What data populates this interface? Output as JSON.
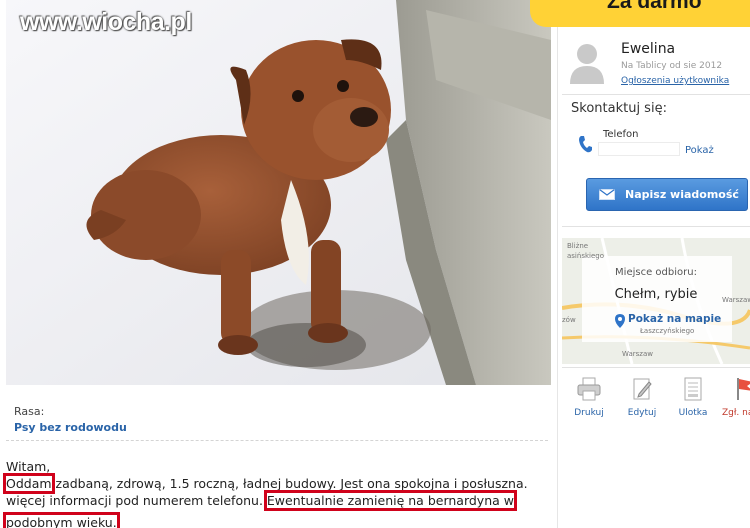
{
  "watermark": "www.wiocha.pl",
  "price": "Za darmo",
  "seller": {
    "name": "Ewelina",
    "member_since": "Na Tablicy od sie 2012",
    "ads_link": "Ogłoszenia użytkownika"
  },
  "contact": {
    "title": "Skontaktuj się:",
    "phone_label": "Telefon",
    "phone_show": "Pokaż",
    "message_button": "Napisz wiadomość"
  },
  "map": {
    "pickup_label": "Miejsce odbioru:",
    "city": "Chełm, rybie",
    "show_map": "Pokaż na mapie",
    "labels": [
      "Bliżne",
      "asińskiego",
      "Warszaw",
      "zów",
      "Łaszczyńskiego",
      "Warszaw"
    ]
  },
  "tools": [
    {
      "label": "Drukuj",
      "icon": "printer-icon"
    },
    {
      "label": "Edytuj",
      "icon": "edit-icon"
    },
    {
      "label": "Ulotka",
      "icon": "flyer-icon"
    },
    {
      "label": "Zgł. narusz",
      "icon": "flag-icon"
    }
  ],
  "attribute": {
    "label": "Rasa:",
    "value": "Psy bez rodowodu"
  },
  "description": {
    "greeting": "Witam,",
    "l2_boxed": "Oddam",
    "l2_rest": " zadbaną, zdrową, 1.5 roczną, ładnej budowy. Jest ona spokojna i posłuszna.",
    "l3_plain": "więcej informacji pod numerem telefonu. ",
    "l3_boxed": "Ewentualnie zamienię na bernardyna w",
    "l4_boxed": "podobnym wieku."
  },
  "colors": {
    "accent_link": "#2a64a8",
    "price_banner": "#ffd236",
    "button_blue": "#2f74c8",
    "highlight_box": "#d0021b"
  }
}
